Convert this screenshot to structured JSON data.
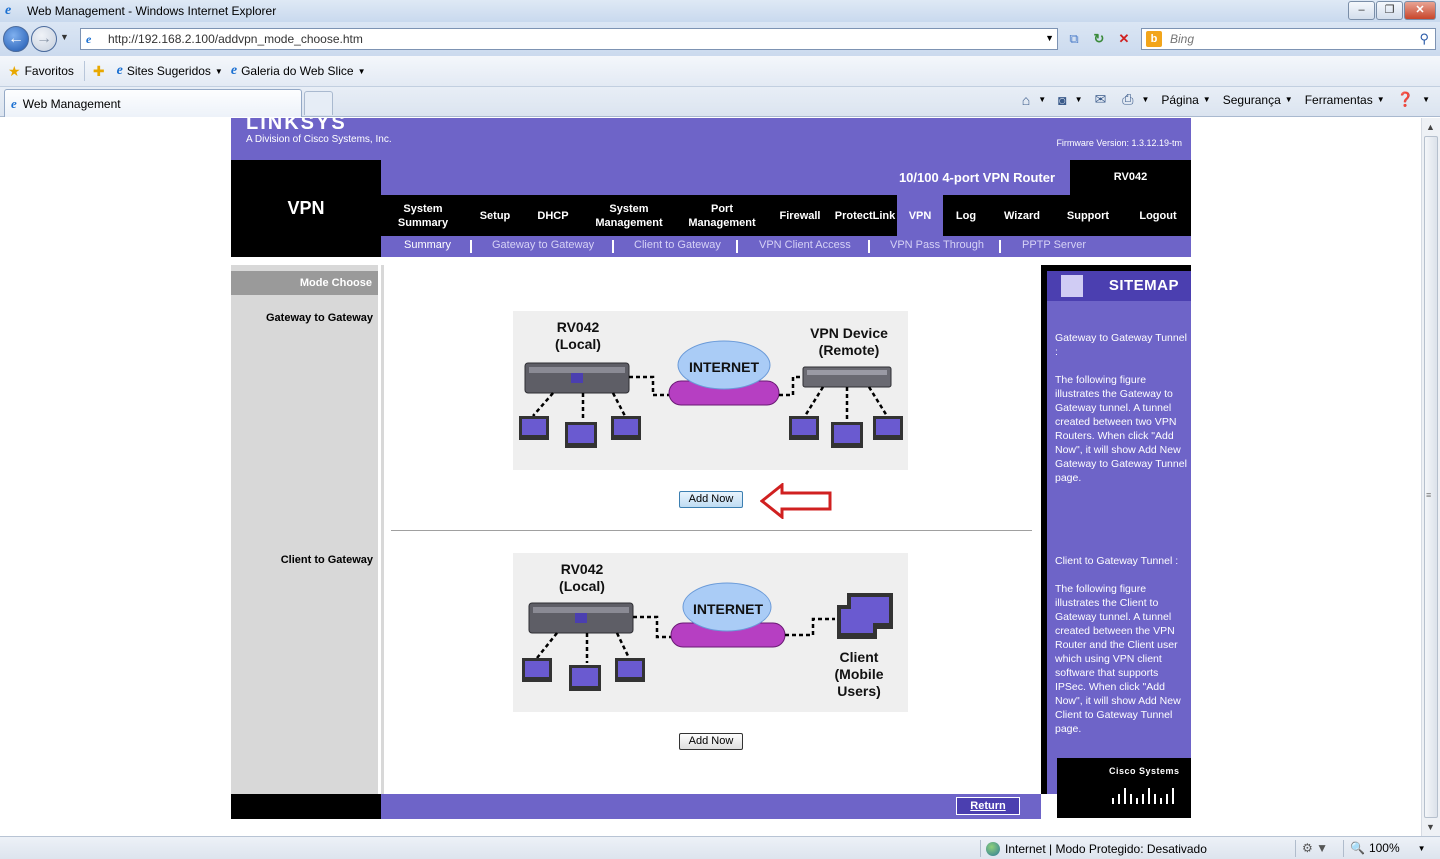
{
  "window": {
    "title": "Web Management - Windows Internet Explorer"
  },
  "address": {
    "url": "http://192.168.2.100/addvpn_mode_choose.htm"
  },
  "search": {
    "placeholder": "Bing"
  },
  "favorites": {
    "favorites_label": "Favoritos",
    "suggested_sites": "Sites Sugeridos",
    "web_slice_gallery": "Galeria do Web Slice"
  },
  "tabs": {
    "active_label": "Web Management"
  },
  "commandbar": {
    "page": "Página",
    "security": "Segurança",
    "tools": "Ferramentas"
  },
  "router": {
    "logo": "LINKSYS",
    "division": "A Division of Cisco Systems, Inc.",
    "firmware": "Firmware Version: 1.3.12.19-tm",
    "section_title": "VPN",
    "product_name": "10/100 4-port VPN Router",
    "model": "RV042",
    "nav": [
      {
        "label": "System\nSummary"
      },
      {
        "label": "Setup"
      },
      {
        "label": "DHCP"
      },
      {
        "label": "System\nManagement"
      },
      {
        "label": "Port\nManagement"
      },
      {
        "label": "Firewall"
      },
      {
        "label": "ProtectLink"
      },
      {
        "label": "VPN"
      },
      {
        "label": "Log"
      },
      {
        "label": "Wizard"
      },
      {
        "label": "Support"
      },
      {
        "label": "Logout"
      }
    ],
    "subnav": [
      {
        "label": "Summary"
      },
      {
        "label": "Gateway to Gateway"
      },
      {
        "label": "Client to Gateway"
      },
      {
        "label": "VPN Client Access"
      },
      {
        "label": "VPN Pass Through"
      },
      {
        "label": "PPTP Server"
      }
    ],
    "mode_choose": "Mode Choose",
    "gateway_label": "Gateway to Gateway",
    "client_label": "Client to Gateway",
    "diagram1": {
      "local_title": "RV042",
      "local_sub": "(Local)",
      "internet": "INTERNET",
      "remote_title": "VPN Device",
      "remote_sub": "(Remote)"
    },
    "diagram2": {
      "local_title": "RV042",
      "local_sub": "(Local)",
      "internet": "INTERNET",
      "client_title": "Client",
      "client_sub": "(Mobile Users)"
    },
    "add_now": "Add Now",
    "return": "Return",
    "sitemap": {
      "title": "SITEMAP",
      "gw_heading": "Gateway to Gateway Tunnel :",
      "gw_text": "The following figure illustrates the Gateway to Gateway tunnel. A tunnel created between two VPN Routers. When click \"Add Now\", it will show Add New Gateway to Gateway Tunnel page.",
      "cl_heading": "Client to Gateway Tunnel :",
      "cl_text": "The following figure illustrates the Client to Gateway tunnel. A tunnel created between the VPN Router and the Client user which using VPN client software that supports IPSec. When click \"Add Now\", it will show Add New Client to Gateway Tunnel page.",
      "cisco": "Cisco Systems"
    }
  },
  "status": {
    "zone": "Internet | Modo Protegido: Desativado",
    "zoom": "100%"
  },
  "colors": {
    "linksys_purple": "#6e64c8",
    "linksys_dark_purple": "#4b3fb0",
    "arrow_red": "#d02020"
  }
}
